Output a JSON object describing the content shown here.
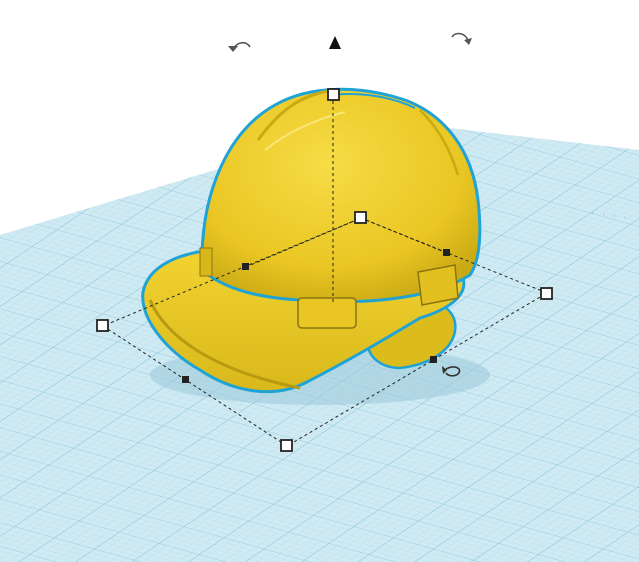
{
  "workspace": {
    "colors": {
      "background": "#ffffff",
      "grid_fill": "#cfeaf3",
      "grid_minor": "#a9d6e6",
      "grid_major": "#7fc0d8",
      "object_fill": "#f0cf2a",
      "object_shadow": "#c9a914",
      "selection_outline": "#1fa3d6",
      "bbox_line": "#222222",
      "handle_fill": "#ffffff",
      "handle_stroke": "#222222"
    }
  },
  "controls": {
    "rotate_left_icon": "rotate-counterclockwise",
    "lift_icon": "up-arrow-cone",
    "rotate_right_icon": "rotate-clockwise",
    "rotate_base_icon": "rotate-around-z"
  },
  "object": {
    "icon": "hard-hat",
    "selected": true
  }
}
